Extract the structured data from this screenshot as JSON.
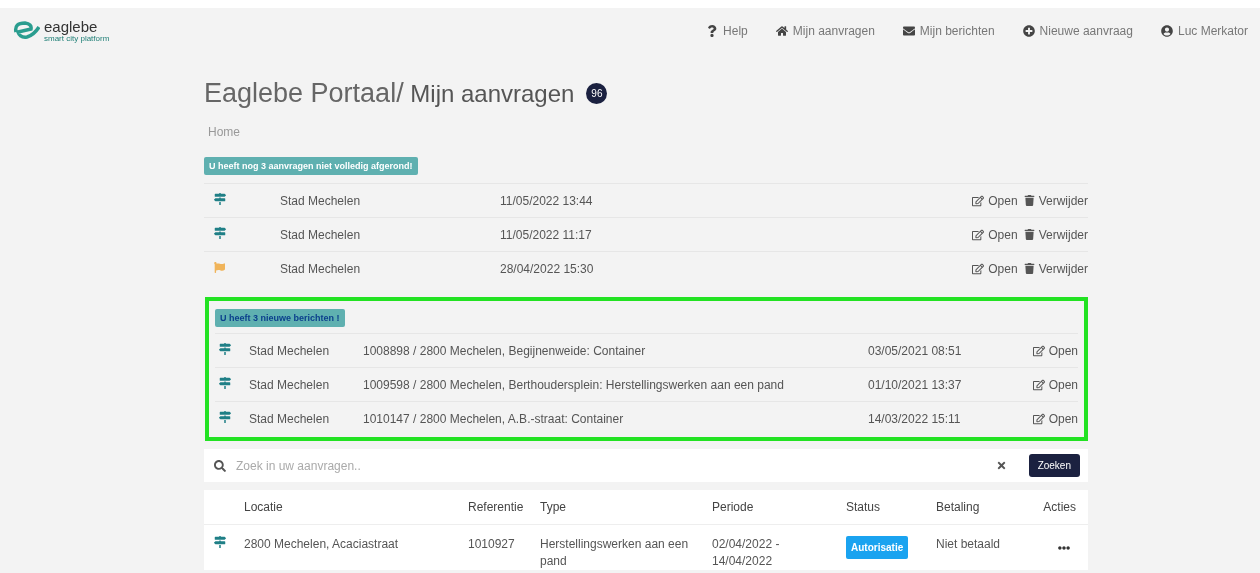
{
  "logo": {
    "name": "eaglebe",
    "tagline": "smart city platform"
  },
  "nav": [
    {
      "kind": "help",
      "label": "Help"
    },
    {
      "kind": "home",
      "label": "Mijn aanvragen"
    },
    {
      "kind": "mail",
      "label": "Mijn berichten"
    },
    {
      "kind": "plus",
      "label": "Nieuwe aanvraag"
    },
    {
      "kind": "user",
      "label": "Luc Merkator"
    }
  ],
  "title": {
    "portal": "Eaglebe Portaal/",
    "page": "Mijn aanvragen",
    "count": "96"
  },
  "breadcrumb": "Home",
  "drafts": {
    "banner": "U heeft nog 3 aanvragen niet volledig afgerond!",
    "rows": [
      {
        "kind": "sign",
        "city": "Stad Mechelen",
        "date": "11/05/2022 13:44",
        "open_label": "Open",
        "delete_label": "Verwijder"
      },
      {
        "kind": "sign",
        "city": "Stad Mechelen",
        "date": "11/05/2022 11:17",
        "open_label": "Open",
        "delete_label": "Verwijder"
      },
      {
        "kind": "flag",
        "city": "Stad Mechelen",
        "date": "28/04/2022 15:30",
        "open_label": "Open",
        "delete_label": "Verwijder"
      }
    ]
  },
  "messages": {
    "banner": "U heeft 3 nieuwe berichten !",
    "rows": [
      {
        "kind": "sign",
        "city": "Stad Mechelen",
        "subject": "1008898 / 2800 Mechelen, Begijnenweide: Container",
        "date": "03/05/2021 08:51",
        "open_label": "Open"
      },
      {
        "kind": "sign",
        "city": "Stad Mechelen",
        "subject": "1009598 / 2800 Mechelen, Berthoudersplein: Herstellingswerken aan een pand",
        "date": "01/10/2021 13:37",
        "open_label": "Open"
      },
      {
        "kind": "sign",
        "city": "Stad Mechelen",
        "subject": "1010147 / 2800 Mechelen, A.B.-straat: Container",
        "date": "14/03/2022 15:11",
        "open_label": "Open"
      }
    ]
  },
  "search": {
    "placeholder": "Zoek in uw aanvragen..",
    "button": "Zoeken"
  },
  "table": {
    "columns": [
      "Locatie",
      "Referentie",
      "Type",
      "Periode",
      "Status",
      "Betaling",
      "Acties"
    ],
    "rows": [
      {
        "kind": "sign",
        "location": "2800 Mechelen, Acaciastraat",
        "reference": "1010927",
        "type": "Herstellingswerken aan een pand",
        "period": "02/04/2022 - 14/04/2022",
        "status": "Autorisatie",
        "color": "#1aa3f0",
        "payment": "Niet betaald"
      }
    ]
  }
}
